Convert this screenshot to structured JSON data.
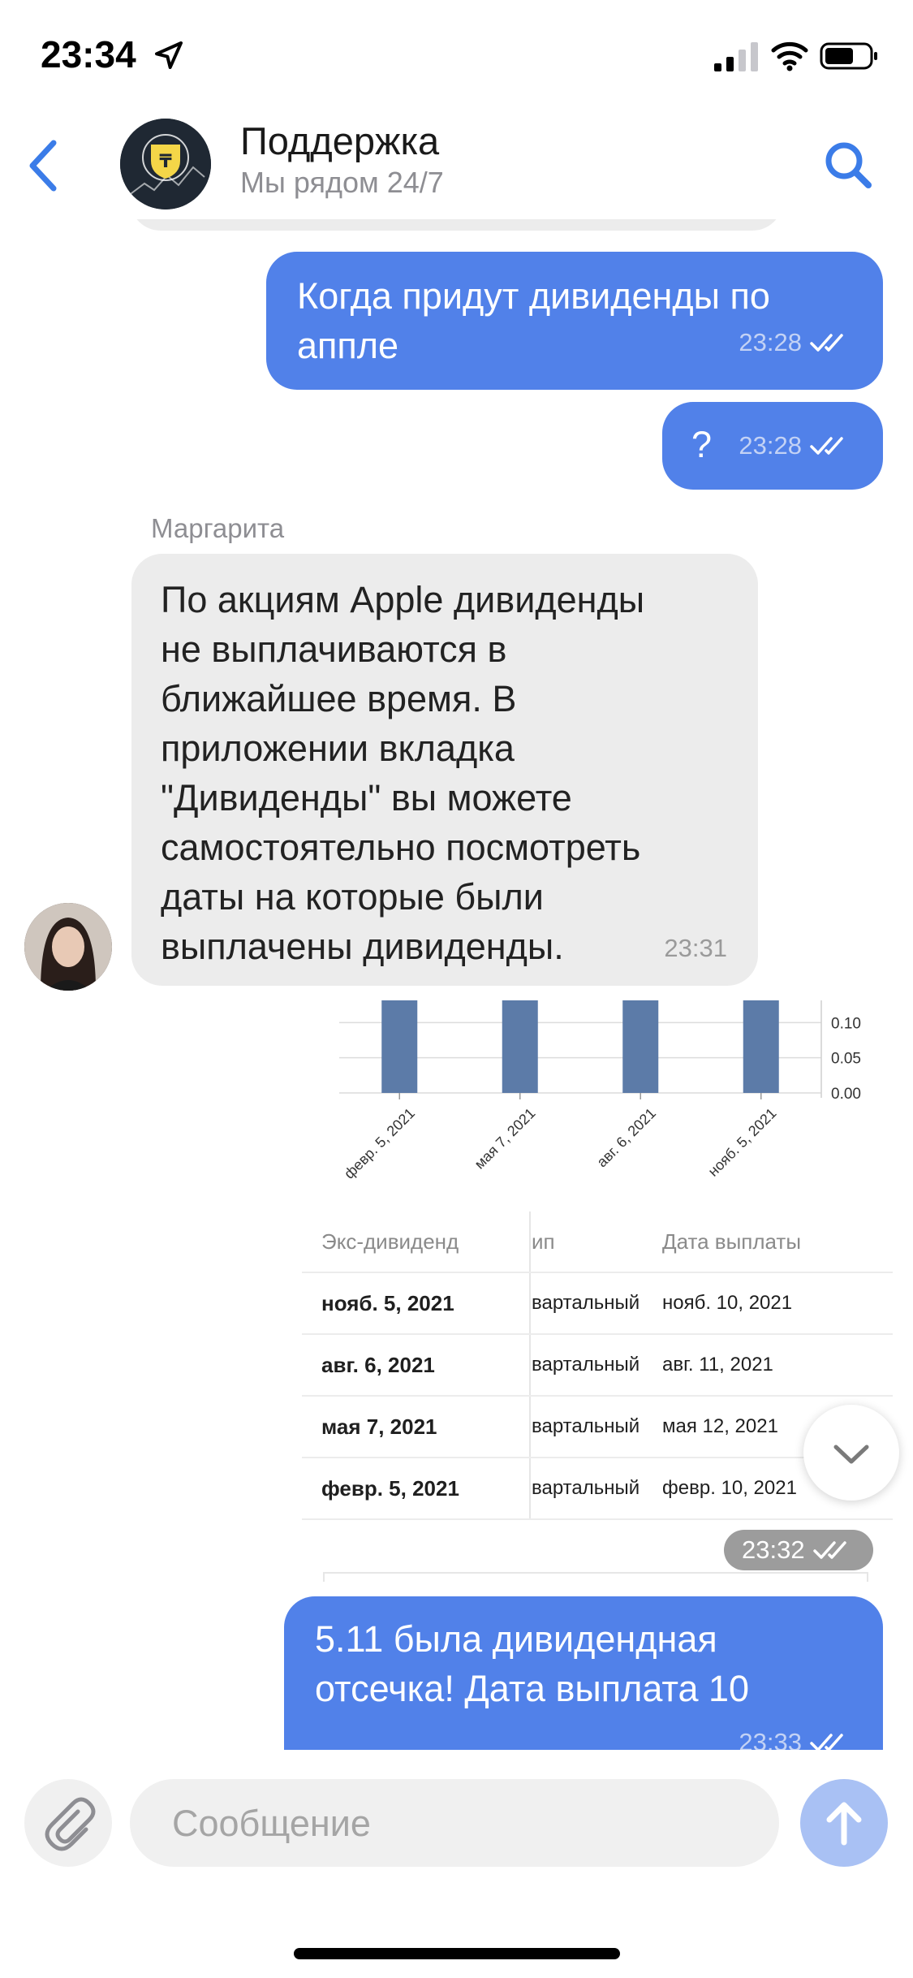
{
  "status_bar": {
    "time": "23:34"
  },
  "header": {
    "title": "Поддержка",
    "subtitle": "Мы рядом 24/7"
  },
  "messages": {
    "m1": {
      "text": "Когда придут дивиденды по\nаппле",
      "time": "23:28"
    },
    "m2": {
      "text": "?",
      "time": "23:28"
    },
    "m3": {
      "sender": "Маргарита",
      "text": "По акциям Apple дивиденды\nне выплачиваются в\nближайшее время. В\nприложении вкладка\n\"Дивиденды\" вы можете\nсамостоятельно посмотреть\nдаты на которые были\nвыплачены дивиденды.",
      "time": "23:31"
    },
    "m4": {
      "time": "23:32",
      "chart_data": {
        "type": "bar",
        "categories": [
          "февр. 5, 2021",
          "мая 7, 2021",
          "авг. 6, 2021",
          "нояб. 5, 2021"
        ],
        "values": [
          0.205,
          0.22,
          0.22,
          0.22
        ],
        "y_ticks": [
          "0.10",
          "0.05",
          "0.00"
        ],
        "ylim": [
          0,
          0.12
        ],
        "bar_color": "#5c7ba8"
      },
      "table": {
        "headers": [
          "Экс-дивиденд",
          "ип",
          "Дата выплаты"
        ],
        "rows": [
          [
            "нояб. 5, 2021",
            "вартальный",
            "нояб. 10, 2021"
          ],
          [
            "авг. 6, 2021",
            "вартальный",
            "авг. 11, 2021"
          ],
          [
            "мая 7, 2021",
            "вартальный",
            "мая 12, 2021"
          ],
          [
            "февр. 5, 2021",
            "вартальный",
            "февр. 10, 2021"
          ]
        ]
      }
    },
    "m5": {
      "text": "5.11 была дивидендная\nотсечка! Дата выплата 10",
      "time": "23:33"
    }
  },
  "input": {
    "placeholder": "Сообщение"
  },
  "colors": {
    "accent": "#5181e9",
    "incoming": "#ececec",
    "send_disabled": "#a9c1f4"
  }
}
